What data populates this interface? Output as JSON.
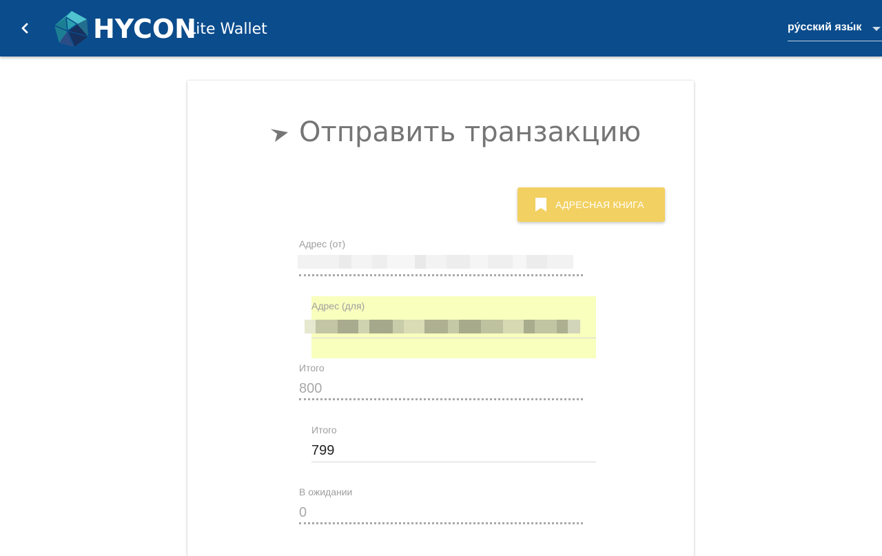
{
  "header": {
    "brand": "HYCON",
    "product": "Lite Wallet",
    "language": "ру́сский язы́к",
    "colors": {
      "appbar": "#0a4c8c",
      "text": "#ffffff"
    }
  },
  "card": {
    "title": "Отправить транзакцию",
    "address_book_button": "АДРЕСНАЯ КНИГА",
    "fields": {
      "from_address": {
        "label": "Адрес (от)",
        "value": ""
      },
      "to_address": {
        "label": "Адрес (для)",
        "value": ""
      },
      "total_disabled": {
        "label": "Итого",
        "value": "800"
      },
      "total_input": {
        "label": "Итого",
        "value": "799"
      },
      "pending": {
        "label": "В ожидании",
        "value": "0"
      }
    },
    "colors": {
      "button": "#f2d061",
      "highlight": "#f9ffbd"
    }
  },
  "icons": {
    "back": "chevron-left-icon",
    "logo": "hycon-logo-icon",
    "send": "send-icon",
    "bookmark": "bookmark-icon",
    "caret": "caret-down-icon"
  }
}
